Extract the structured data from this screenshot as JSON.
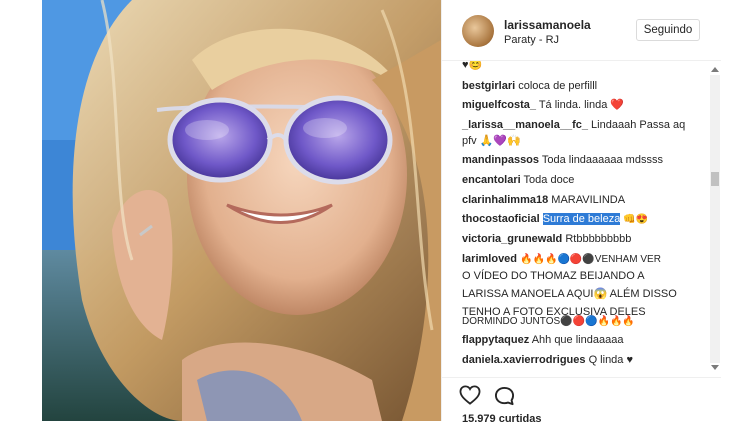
{
  "post": {
    "username": "larissamanoela",
    "location": "Paraty - RJ",
    "follow_label": "Seguindo",
    "likes_text": "15.979 curtidas"
  },
  "comments": [
    {
      "user": "",
      "text": "♥😊"
    },
    {
      "user": "bestgirlari",
      "text": "coloca de perfilll"
    },
    {
      "user": "miguelfcosta_",
      "text": "Tá linda. linda ❤️"
    },
    {
      "user": "_larissa__manoela__fc_",
      "text": "Lindaaah Passa aq"
    },
    {
      "user": "",
      "text": "pfv 🙏💜🙌"
    },
    {
      "user": "mandinpassos",
      "text": "Toda lindaaaaaa mdssss"
    },
    {
      "user": "encantolari",
      "text": "Toda doce"
    },
    {
      "user": "clarinhalimma18",
      "text": "MARAVILINDA"
    },
    {
      "user": "thocostaoficial",
      "text_highlight": "Surra de beleza",
      "text_after": "👊😍"
    },
    {
      "user": "victoria_grunewald",
      "text": "Rtbbbbbbbbb"
    },
    {
      "user": "larimloved",
      "text": "🔥🔥🔥🔵🔴⚫VENHAM VER"
    },
    {
      "user": "",
      "text": "O VÍDEO DO THOMAZ BEIJANDO A"
    },
    {
      "user": "",
      "text": "LARISSA MANOELA AQUI😱 ALÉM DISSO"
    },
    {
      "user": "",
      "text": "TENHO A FOTO EXCLUSIVA DELES"
    },
    {
      "user": "",
      "text": "DORMINDO JUNTOS⚫🔴🔵🔥🔥🔥"
    },
    {
      "user": "flappytaquez",
      "text": "Ahh que lindaaaaa"
    },
    {
      "user": "daniela.xavierrodrigues",
      "text": "Q linda ♥"
    }
  ],
  "icons": {
    "like": "heart-outline-icon",
    "comment": "speech-bubble-icon"
  }
}
